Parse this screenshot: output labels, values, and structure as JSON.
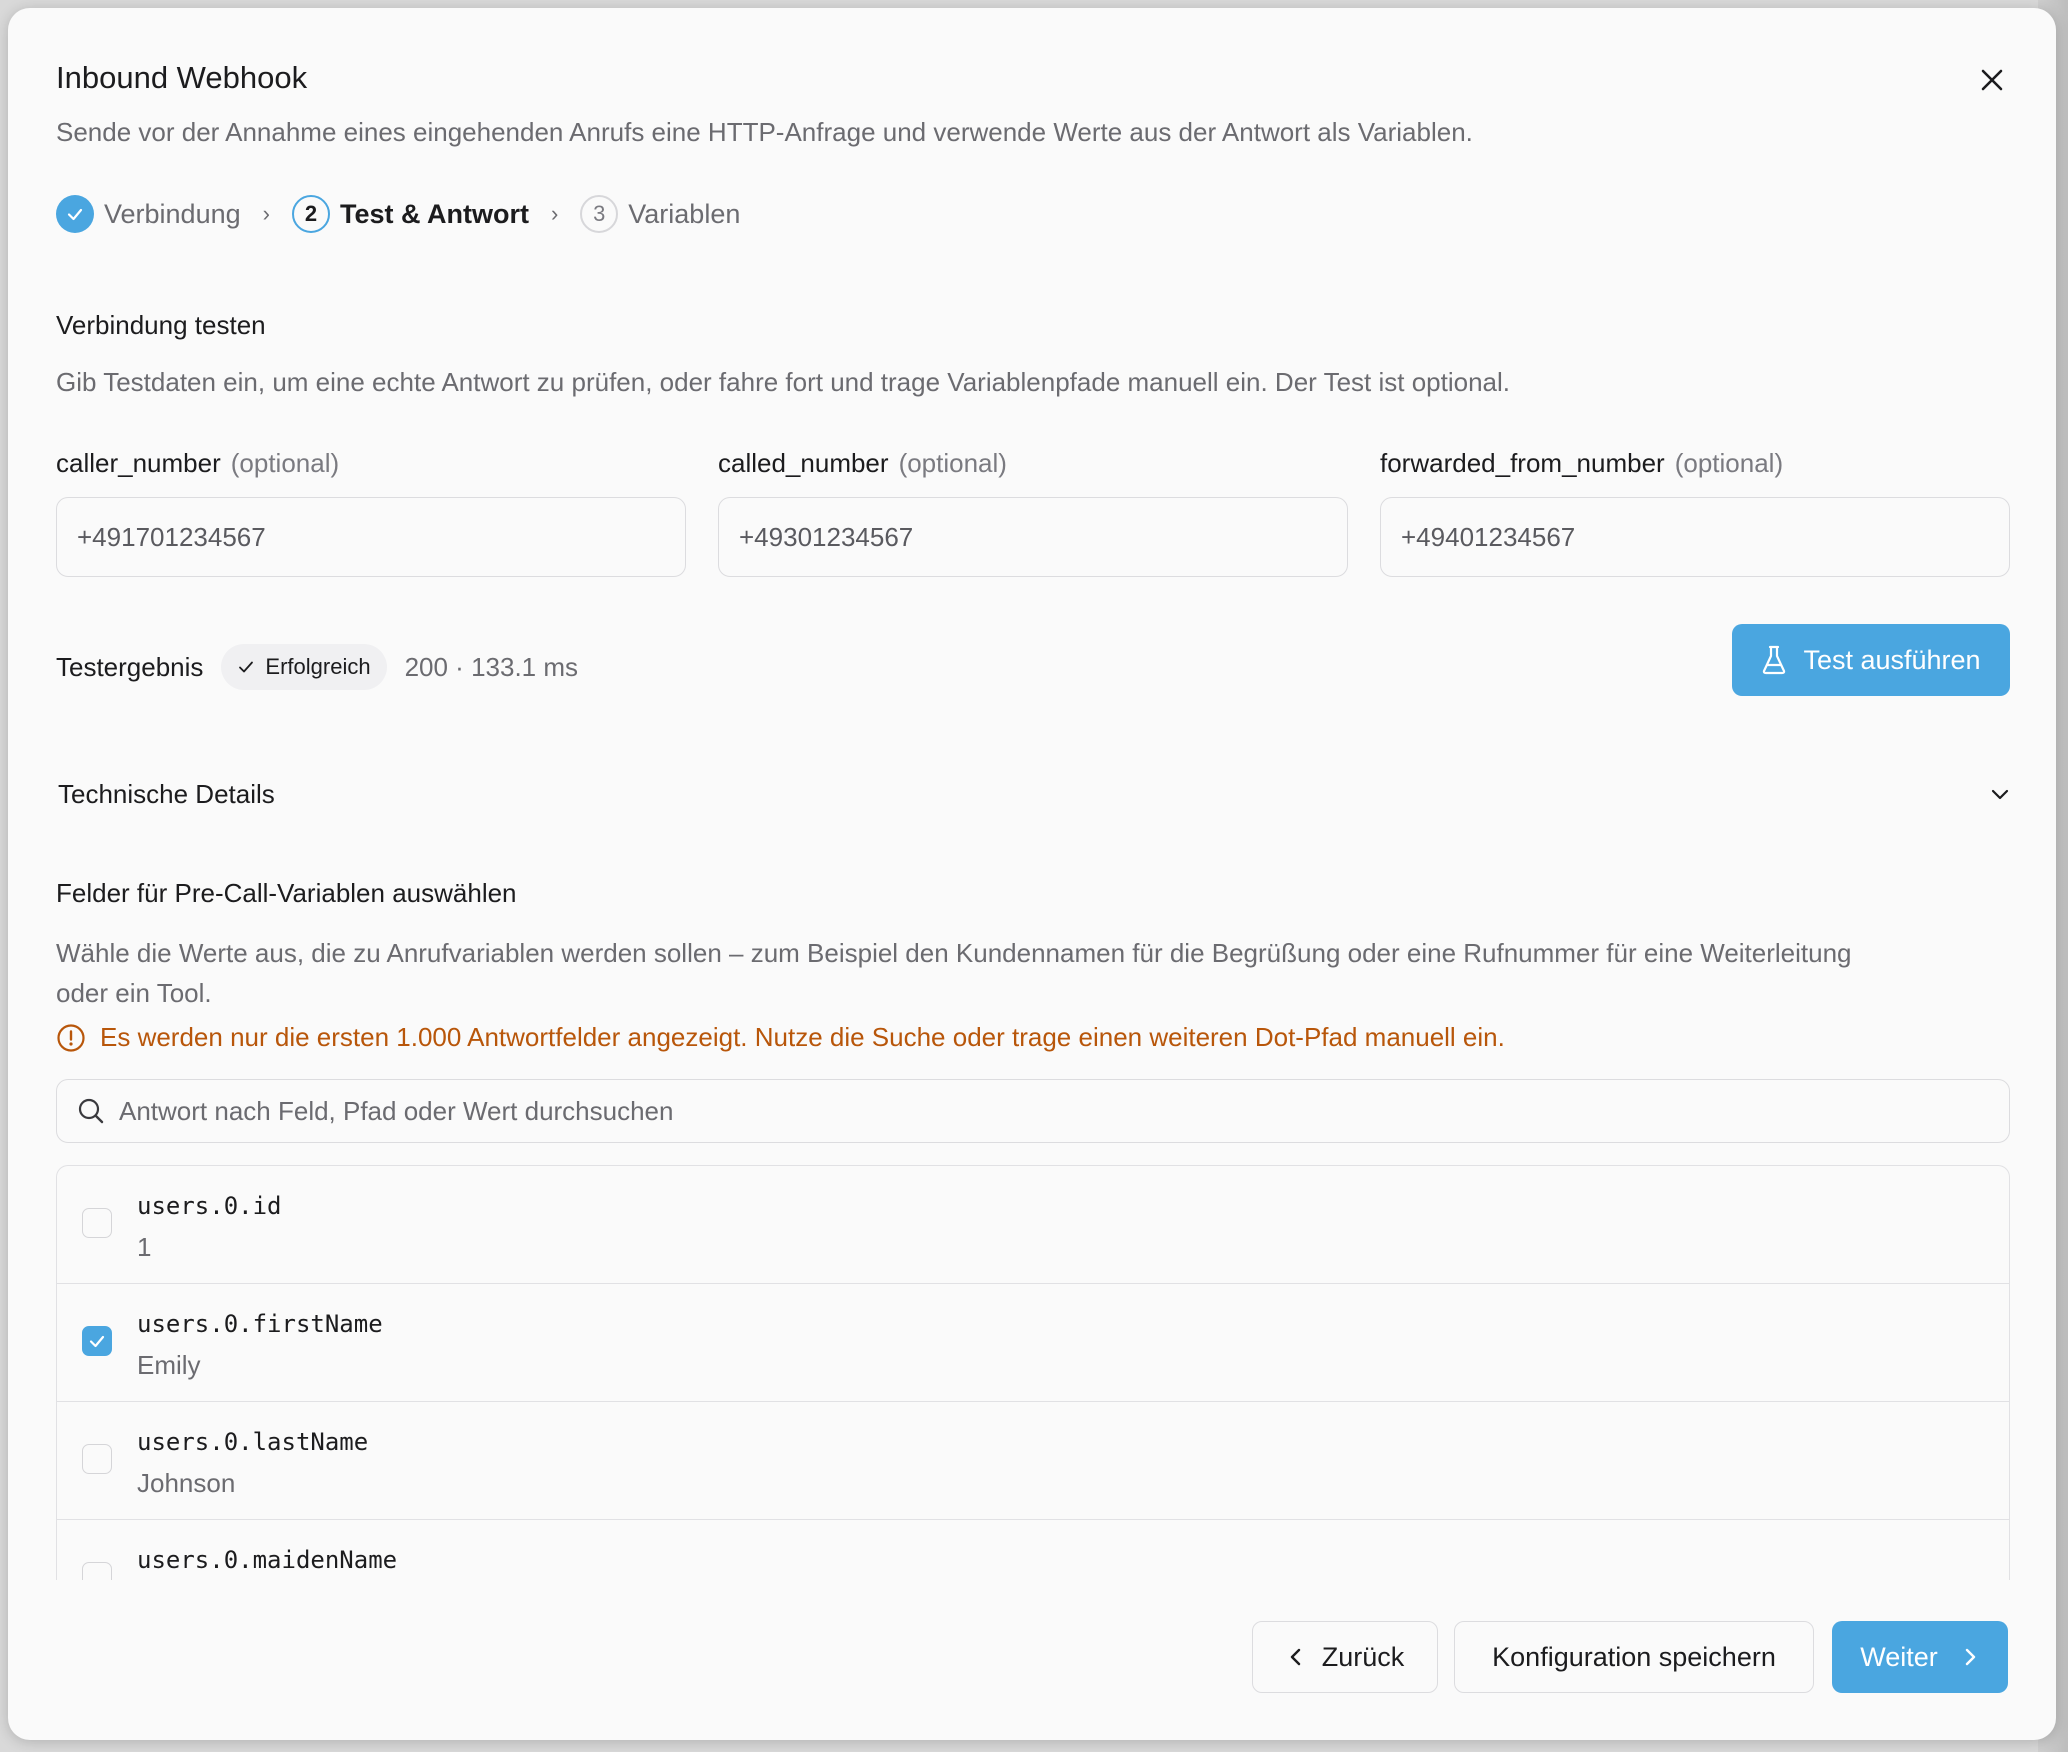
{
  "dialog": {
    "title": "Inbound Webhook",
    "subtitle": "Sende vor der Annahme eines eingehenden Anrufs eine HTTP-Anfrage und verwende Werte aus der Antwort als Variablen."
  },
  "stepper": {
    "steps": [
      {
        "number": "",
        "label": "Verbindung",
        "state": "done"
      },
      {
        "number": "2",
        "label": "Test & Antwort",
        "state": "active"
      },
      {
        "number": "3",
        "label": "Variablen",
        "state": "upcoming"
      }
    ],
    "separator": "›"
  },
  "test_section": {
    "title": "Verbindung testen",
    "description": "Gib Testdaten ein, um eine echte Antwort zu prüfen, oder fahre fort und trage Variablenpfade manuell ein. Der Test ist optional.",
    "fields": [
      {
        "label": "caller_number",
        "optional": "(optional)",
        "value": "+491701234567"
      },
      {
        "label": "called_number",
        "optional": "(optional)",
        "value": "+49301234567"
      },
      {
        "label": "forwarded_from_number",
        "optional": "(optional)",
        "value": "+49401234567"
      }
    ],
    "result_label": "Testergebnis",
    "result_badge": "Erfolgreich",
    "result_meta": "200 · 133.1 ms",
    "run_button": "Test ausführen"
  },
  "details": {
    "label": "Technische Details"
  },
  "fields_section": {
    "title": "Felder für Pre-Call-Variablen auswählen",
    "description_line1": "Wähle die Werte aus, die zu Anrufvariablen werden sollen – zum Beispiel den Kundennamen für die Begrüßung oder eine Rufnummer für eine Weiterleitung",
    "description_line2": "oder ein Tool.",
    "warning": "Es werden nur die ersten 1.000 Antwortfelder angezeigt. Nutze die Suche oder trage einen weiteren Dot-Pfad manuell ein.",
    "search_placeholder": "Antwort nach Feld, Pfad oder Wert durchsuchen",
    "rows": [
      {
        "path": "users.0.id",
        "value": "1",
        "checked": false
      },
      {
        "path": "users.0.firstName",
        "value": "Emily",
        "checked": true
      },
      {
        "path": "users.0.lastName",
        "value": "Johnson",
        "checked": false
      },
      {
        "path": "users.0.maidenName",
        "value": "",
        "checked": false
      }
    ]
  },
  "footer": {
    "back": "Zurück",
    "save": "Konfiguration speichern",
    "next": "Weiter"
  },
  "colors": {
    "accent": "#4aa6e0",
    "warning": "#b8560a"
  }
}
